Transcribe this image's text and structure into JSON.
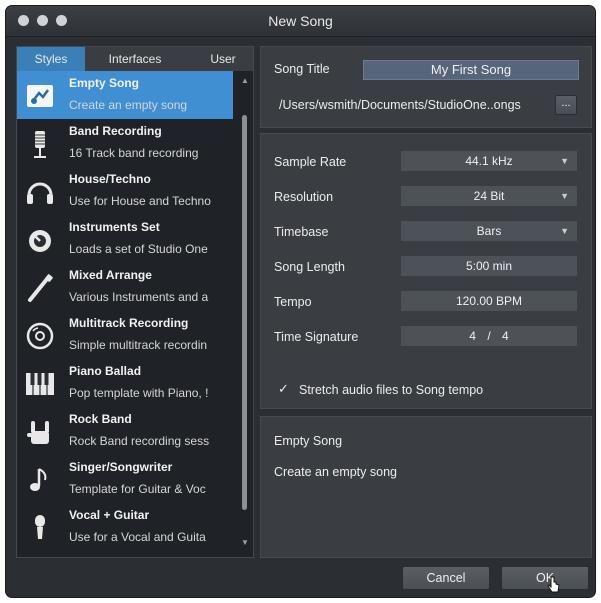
{
  "window": {
    "title": "New Song"
  },
  "tabs": [
    {
      "label": "Styles",
      "active": true
    },
    {
      "label": "Interfaces",
      "active": false
    },
    {
      "label": "User",
      "active": false
    }
  ],
  "templates": [
    {
      "name": "Empty Song",
      "desc": "Create an empty song",
      "icon": "empty-song-icon",
      "selected": true
    },
    {
      "name": "Band Recording",
      "desc": "16 Track band recording",
      "icon": "microphone-icon"
    },
    {
      "name": "House/Techno",
      "desc": "Use for House and Techno",
      "icon": "headphones-icon"
    },
    {
      "name": "Instruments Set",
      "desc": "Loads a set of  Studio One",
      "icon": "knob-icon"
    },
    {
      "name": "Mixed Arrange",
      "desc": "Various Instruments and a",
      "icon": "guitar-neck-icon"
    },
    {
      "name": "Multitrack Recording",
      "desc": "Simple multitrack recordin",
      "icon": "disc-icon"
    },
    {
      "name": "Piano Ballad",
      "desc": "Pop template with Piano, !",
      "icon": "piano-keys-icon"
    },
    {
      "name": "Rock Band",
      "desc": "Rock Band recording sess",
      "icon": "rock-hand-icon"
    },
    {
      "name": "Singer/Songwriter",
      "desc": "Template for Guitar & Voc",
      "icon": "music-note-icon"
    },
    {
      "name": "Vocal + Guitar",
      "desc": "Use for a Vocal and Guita",
      "icon": "vocal-mic-icon"
    }
  ],
  "song": {
    "title_label": "Song Title",
    "title_value": "My First Song",
    "path": "/Users/wsmith/Documents/StudioOne..ongs",
    "browse_label": "..."
  },
  "settings": {
    "sample_rate": {
      "label": "Sample Rate",
      "value": "44.1 kHz"
    },
    "resolution": {
      "label": "Resolution",
      "value": "24 Bit"
    },
    "timebase": {
      "label": "Timebase",
      "value": "Bars"
    },
    "song_length": {
      "label": "Song Length",
      "value": "5:00 min"
    },
    "tempo": {
      "label": "Tempo",
      "value": "120.00 BPM"
    },
    "time_signature": {
      "label": "Time Signature",
      "numerator": "4",
      "separator": "/",
      "denominator": "4"
    },
    "stretch": {
      "checked": true,
      "check_glyph": "✓",
      "label": "Stretch audio files to Song tempo"
    }
  },
  "description": {
    "title": "Empty Song",
    "text": "Create an empty song"
  },
  "buttons": {
    "cancel": "Cancel",
    "ok": "OK"
  }
}
